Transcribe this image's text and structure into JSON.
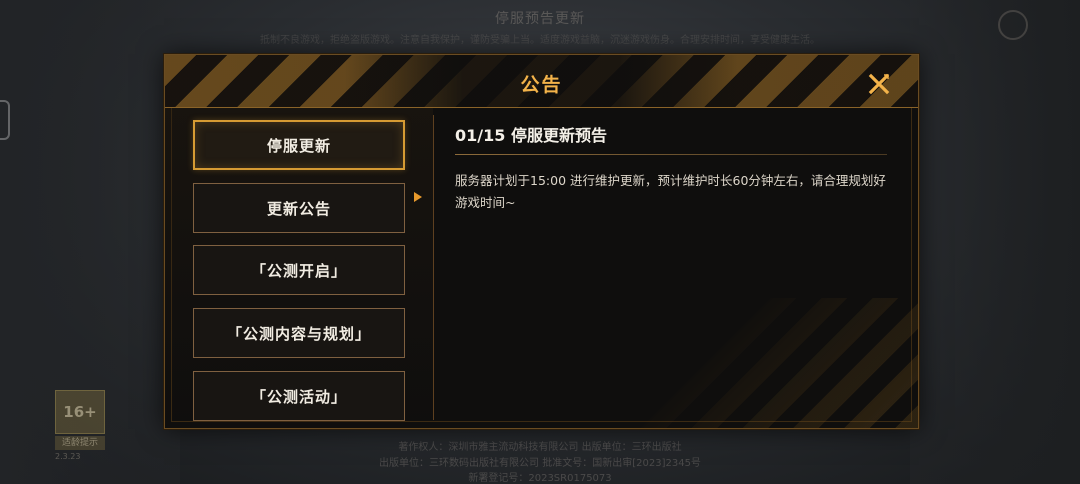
{
  "background": {
    "title": "停服预告更新",
    "subtitle": "抵制不良游戏，拒绝盗版游戏。注意自我保护，谨防受骗上当。适度游戏益脑，沉迷游戏伤身。合理安排时间，享受健康生活。",
    "age_rating": {
      "label": "16+",
      "tag": "适龄提示",
      "code": "2.3.23"
    },
    "footer_lines": [
      "著作权人：深圳市雅主流动科技有限公司   出版单位：三环出版社",
      "出版单位：三环数码出版社有限公司   批准文号：国新出审[2023]2345号",
      "新署登记号：2023SR0175073"
    ]
  },
  "modal": {
    "title": "公告",
    "close_icon": "close-x-icon",
    "accent_color": "#f3b34a"
  },
  "tabs": [
    {
      "label": "停服更新",
      "active": true
    },
    {
      "label": "更新公告",
      "active": false
    },
    {
      "label": "「公测开启」",
      "active": false
    },
    {
      "label": "「公测内容与规划」",
      "active": false
    },
    {
      "label": "「公测活动」",
      "active": false
    }
  ],
  "announcement": {
    "title": "01/15 停服更新预告",
    "body": "服务器计划于15:00 进行维护更新，预计维护时长60分钟左右，请合理规划好游戏时间~"
  }
}
